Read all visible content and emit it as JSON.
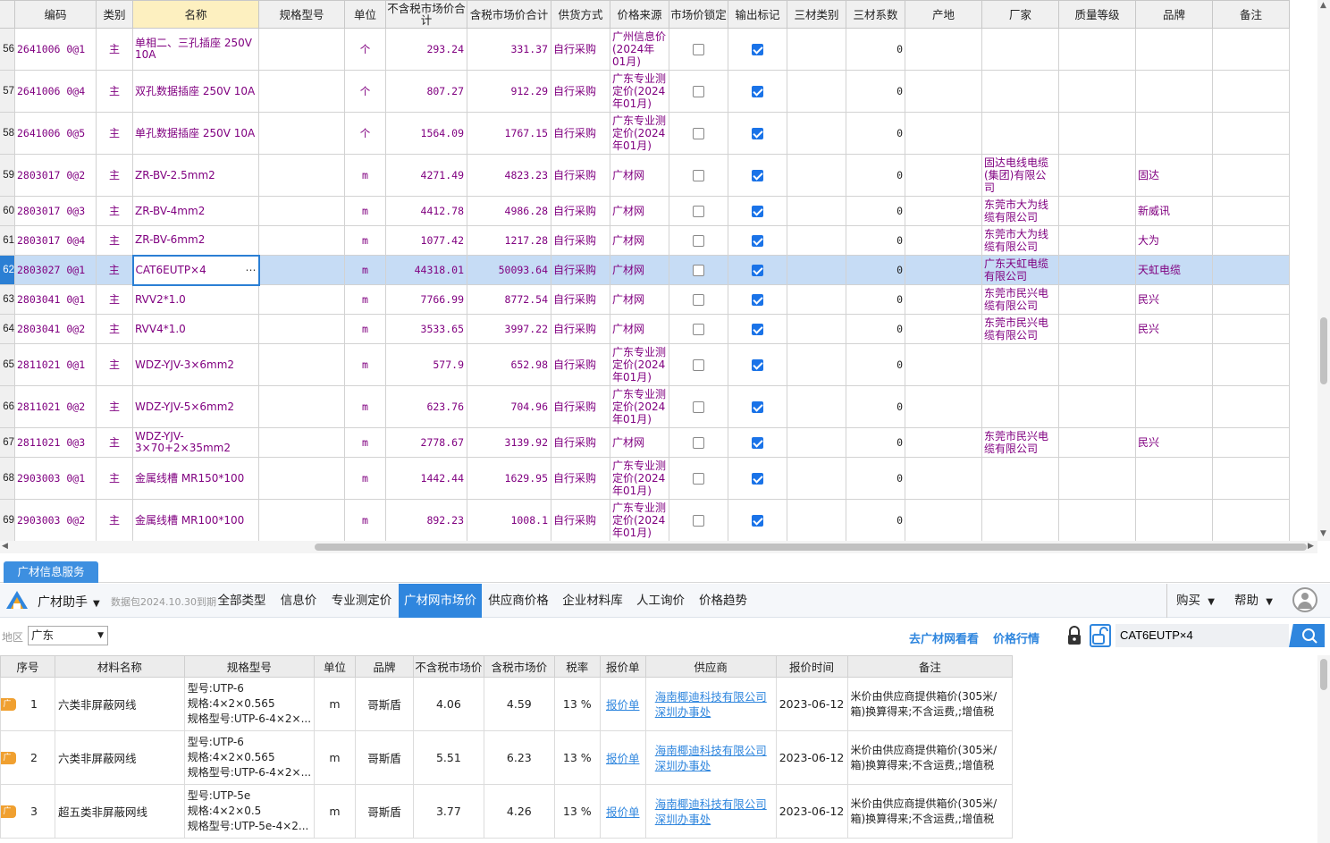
{
  "grid": {
    "columns": [
      "编码",
      "类别",
      "名称",
      "规格型号",
      "单位",
      "不含税市场价合计",
      "含税市场价合计",
      "供货方式",
      "价格来源",
      "市场价锁定",
      "输出标记",
      "三材类别",
      "三材系数",
      "产地",
      "厂家",
      "质量等级",
      "品牌",
      "备注"
    ],
    "rows": [
      {
        "idx": "56",
        "code": "2641006 0@1",
        "cat": "主",
        "name": "单相二、三孔插座 250V 10A",
        "unit": "个",
        "notax": "293.24",
        "tax": "331.37",
        "supply": "自行采购",
        "source": "广州信息价(2024年01月)",
        "lock": false,
        "out": true,
        "coef": "0",
        "maker": "",
        "brand": ""
      },
      {
        "idx": "57",
        "code": "2641006 0@4",
        "cat": "主",
        "name": "双孔数据插座 250V 10A",
        "unit": "个",
        "notax": "807.27",
        "tax": "912.29",
        "supply": "自行采购",
        "source": "广东专业测定价(2024年01月)",
        "lock": false,
        "out": true,
        "coef": "0",
        "maker": "",
        "brand": ""
      },
      {
        "idx": "58",
        "code": "2641006 0@5",
        "cat": "主",
        "name": "单孔数据插座 250V 10A",
        "unit": "个",
        "notax": "1564.09",
        "tax": "1767.15",
        "supply": "自行采购",
        "source": "广东专业测定价(2024年01月)",
        "lock": false,
        "out": true,
        "coef": "0",
        "maker": "",
        "brand": ""
      },
      {
        "idx": "59",
        "code": "2803017 0@2",
        "cat": "主",
        "name": "ZR-BV-2.5mm2",
        "unit": "m",
        "notax": "4271.49",
        "tax": "4823.23",
        "supply": "自行采购",
        "source": "广材网",
        "lock": false,
        "out": true,
        "coef": "0",
        "maker": "固达电线电缆(集团)有限公司",
        "brand": "固达"
      },
      {
        "idx": "60",
        "code": "2803017 0@3",
        "cat": "主",
        "name": "ZR-BV-4mm2",
        "unit": "m",
        "notax": "4412.78",
        "tax": "4986.28",
        "supply": "自行采购",
        "source": "广材网",
        "lock": false,
        "out": true,
        "coef": "0",
        "maker": "东莞市大为线缆有限公司",
        "brand": "新威讯"
      },
      {
        "idx": "61",
        "code": "2803017 0@4",
        "cat": "主",
        "name": "ZR-BV-6mm2",
        "unit": "m",
        "notax": "1077.42",
        "tax": "1217.28",
        "supply": "自行采购",
        "source": "广材网",
        "lock": false,
        "out": true,
        "coef": "0",
        "maker": "东莞市大为线缆有限公司",
        "brand": "大为"
      },
      {
        "idx": "62",
        "code": "2803027 0@1",
        "cat": "主",
        "name": "CAT6EUTP×4",
        "unit": "m",
        "notax": "44318.01",
        "tax": "50093.64",
        "supply": "自行采购",
        "source": "广材网",
        "lock": false,
        "out": true,
        "coef": "0",
        "maker": "广东天虹电缆有限公司",
        "brand": "天虹电缆",
        "selected": true
      },
      {
        "idx": "63",
        "code": "2803041 0@1",
        "cat": "主",
        "name": "RVV2*1.0",
        "unit": "m",
        "notax": "7766.99",
        "tax": "8772.54",
        "supply": "自行采购",
        "source": "广材网",
        "lock": false,
        "out": true,
        "coef": "0",
        "maker": "东莞市民兴电缆有限公司",
        "brand": "民兴"
      },
      {
        "idx": "64",
        "code": "2803041 0@2",
        "cat": "主",
        "name": "RVV4*1.0",
        "unit": "m",
        "notax": "3533.65",
        "tax": "3997.22",
        "supply": "自行采购",
        "source": "广材网",
        "lock": false,
        "out": true,
        "coef": "0",
        "maker": "东莞市民兴电缆有限公司",
        "brand": "民兴"
      },
      {
        "idx": "65",
        "code": "2811021 0@1",
        "cat": "主",
        "name": "WDZ-YJV-3×6mm2",
        "unit": "m",
        "notax": "577.9",
        "tax": "652.98",
        "supply": "自行采购",
        "source": "广东专业测定价(2024年01月)",
        "lock": false,
        "out": true,
        "coef": "0",
        "maker": "",
        "brand": ""
      },
      {
        "idx": "66",
        "code": "2811021 0@2",
        "cat": "主",
        "name": "WDZ-YJV-5×6mm2",
        "unit": "m",
        "notax": "623.76",
        "tax": "704.96",
        "supply": "自行采购",
        "source": "广东专业测定价(2024年01月)",
        "lock": false,
        "out": true,
        "coef": "0",
        "maker": "",
        "brand": ""
      },
      {
        "idx": "67",
        "code": "2811021 0@3",
        "cat": "主",
        "name": "WDZ-YJV-3×70+2×35mm2",
        "unit": "m",
        "notax": "2778.67",
        "tax": "3139.92",
        "supply": "自行采购",
        "source": "广材网",
        "lock": false,
        "out": true,
        "coef": "0",
        "maker": "东莞市民兴电缆有限公司",
        "brand": "民兴"
      },
      {
        "idx": "68",
        "code": "2903003 0@1",
        "cat": "主",
        "name": "金属线槽 MR150*100",
        "unit": "m",
        "notax": "1442.44",
        "tax": "1629.95",
        "supply": "自行采购",
        "source": "广东专业测定价(2024年01月)",
        "lock": false,
        "out": true,
        "coef": "0",
        "maker": "",
        "brand": ""
      },
      {
        "idx": "69",
        "code": "2903003 0@2",
        "cat": "主",
        "name": "金属线槽 MR100*100",
        "unit": "m",
        "notax": "892.23",
        "tax": "1008.1",
        "supply": "自行采购",
        "source": "广东专业测定价(2024年01月)",
        "lock": false,
        "out": true,
        "coef": "0",
        "maker": "",
        "brand": ""
      }
    ]
  },
  "panel": {
    "tab": "广材信息服务",
    "helper": "广材助手",
    "package": "数据包2024.10.30到期",
    "nav": [
      "全部类型",
      "信息价",
      "专业测定价",
      "广材网市场价",
      "供应商价格",
      "企业材料库",
      "人工询价",
      "价格趋势"
    ],
    "active_nav": "广材网市场价",
    "buy": "购买",
    "help": "帮助",
    "region_label": "地区",
    "region": "广东",
    "link_visit": "去广材网看看",
    "link_trend": "价格行情",
    "search_value": "CAT6EUTP×4",
    "accent": "#2f86de"
  },
  "results": {
    "columns": [
      "序号",
      "材料名称",
      "规格型号",
      "单位",
      "品牌",
      "不含税市场价",
      "含税市场价",
      "税率",
      "报价单",
      "供应商",
      "报价时间",
      "备注"
    ],
    "badge": "广",
    "rows": [
      {
        "no": "1",
        "name": "六类非屏蔽网线",
        "spec1": "型号:UTP-6",
        "spec2": "规格:4×2×0.565",
        "spec3": "规格型号:UTP-6-4×2×...",
        "unit": "m",
        "brand": "哥斯盾",
        "notax": "4.06",
        "tax": "4.59",
        "rate": "13 %",
        "quote": "报价单",
        "supplier": "海南椰迪科技有限公司深圳办事处",
        "date": "2023-06-12",
        "note": "米价由供应商提供箱价(305米/箱)换算得来;不含运费,;增值税"
      },
      {
        "no": "2",
        "name": "六类非屏蔽网线",
        "spec1": "型号:UTP-6",
        "spec2": "规格:4×2×0.565",
        "spec3": "规格型号:UTP-6-4×2×...",
        "unit": "m",
        "brand": "哥斯盾",
        "notax": "5.51",
        "tax": "6.23",
        "rate": "13 %",
        "quote": "报价单",
        "supplier": "海南椰迪科技有限公司深圳办事处",
        "date": "2023-06-12",
        "note": "米价由供应商提供箱价(305米/箱)换算得来;不含运费,;增值税"
      },
      {
        "no": "3",
        "name": "超五类非屏蔽网线",
        "spec1": "型号:UTP-5e",
        "spec2": "规格:4×2×0.5",
        "spec3": "规格型号:UTP-5e-4×2...",
        "unit": "m",
        "brand": "哥斯盾",
        "notax": "3.77",
        "tax": "4.26",
        "rate": "13 %",
        "quote": "报价单",
        "supplier": "海南椰迪科技有限公司深圳办事处",
        "date": "2023-06-12",
        "note": "米价由供应商提供箱价(305米/箱)换算得来;不含运费,;增值税"
      }
    ]
  }
}
